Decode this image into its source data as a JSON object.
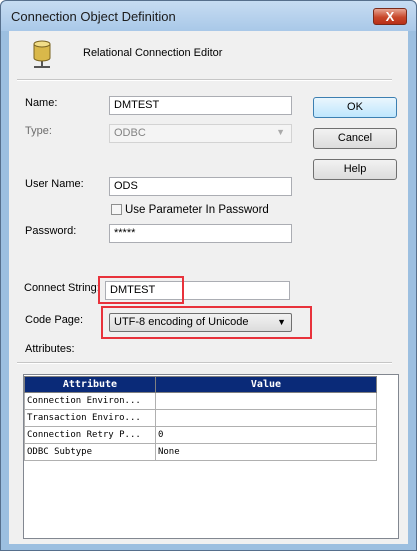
{
  "window": {
    "title": "Connection Object Definition",
    "close_symbol": "X"
  },
  "header": {
    "subtitle": "Relational Connection Editor",
    "icon": "database-icon"
  },
  "form": {
    "name_label": "Name:",
    "name_value": "DMTEST",
    "type_label": "Type:",
    "type_value": "ODBC",
    "user_label": "User Name:",
    "user_value": "ODS",
    "use_param_label": "Use Parameter In Password",
    "use_param_checked": false,
    "password_label": "Password:",
    "password_value": "*****",
    "connect_label": "Connect String:",
    "connect_value": "DMTEST",
    "codepage_label": "Code Page:",
    "codepage_value": "UTF-8 encoding of Unicode",
    "attributes_label": "Attributes:"
  },
  "buttons": {
    "ok": "OK",
    "cancel": "Cancel",
    "help": "Help"
  },
  "attributes_table": {
    "headers": [
      "Attribute",
      "Value"
    ],
    "rows": [
      [
        "Connection Environ...",
        ""
      ],
      [
        "Transaction Enviro...",
        ""
      ],
      [
        "Connection Retry P...",
        "0"
      ],
      [
        "ODBC Subtype",
        "None"
      ]
    ]
  },
  "colors": {
    "title_bar": "#a9c8e8",
    "table_header": "#0a2a78",
    "highlight": "#e8323b"
  }
}
